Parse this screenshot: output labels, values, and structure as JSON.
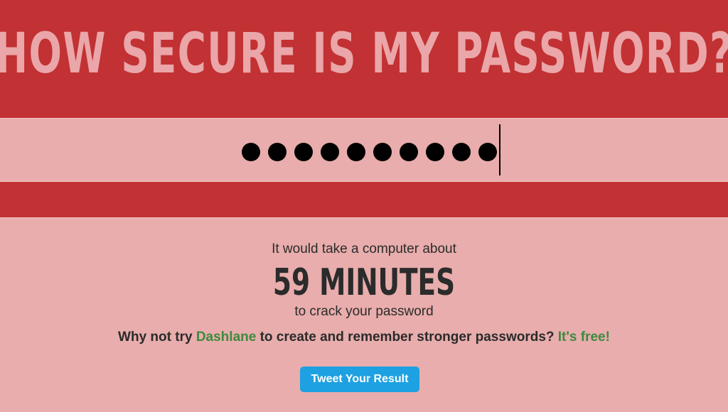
{
  "header": {
    "title": "HOW SECURE IS MY PASSWORD?"
  },
  "password_field": {
    "masked_length": 10,
    "mask_char": "●"
  },
  "result": {
    "intro": "It would take a computer about",
    "time": "59 MINUTES",
    "outro": "to crack your password"
  },
  "promo": {
    "prefix": "Why not try ",
    "link": "Dashlane",
    "middle": " to create and remember stronger passwords? ",
    "free": "It's free!"
  },
  "tweet": {
    "label": "Tweet Your Result"
  },
  "colors": {
    "header_bg": "#c23133",
    "page_bg": "#e8adac",
    "title_text": "#eaa6a8",
    "link_green": "#3d8a3f",
    "tweet_blue": "#1da1e2"
  }
}
